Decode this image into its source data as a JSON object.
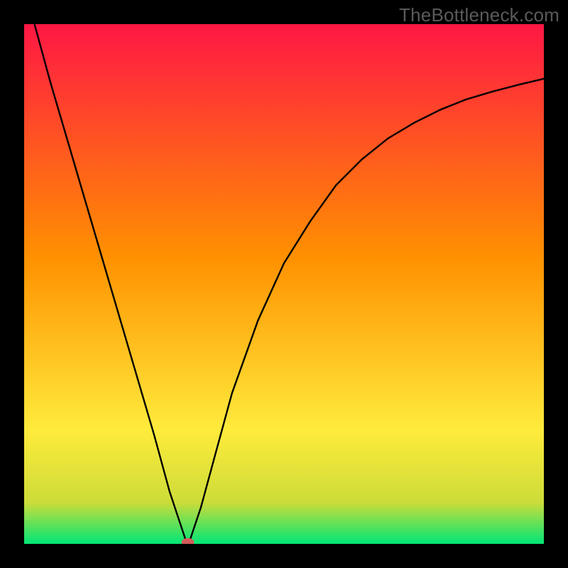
{
  "watermark": "TheBottleneck.com",
  "chart_data": {
    "type": "line",
    "title": "",
    "xlabel": "",
    "ylabel": "",
    "xlim": [
      0,
      1
    ],
    "ylim": [
      0,
      1
    ],
    "background_gradient": {
      "top": "#ff1744",
      "mid_upper": "#ff9100",
      "mid": "#ffeb3b",
      "mid_lower": "#cddc39",
      "bottom": "#00e676"
    },
    "series": [
      {
        "name": "curve",
        "color": "#000000",
        "comment": "V-shaped curve with sharp minimum; left branch nearly linear, right branch concave rising",
        "points": [
          {
            "x": 0.02,
            "y": 1.0
          },
          {
            "x": 0.05,
            "y": 0.89
          },
          {
            "x": 0.1,
            "y": 0.72
          },
          {
            "x": 0.15,
            "y": 0.55
          },
          {
            "x": 0.2,
            "y": 0.38
          },
          {
            "x": 0.25,
            "y": 0.21
          },
          {
            "x": 0.28,
            "y": 0.1
          },
          {
            "x": 0.3,
            "y": 0.04
          },
          {
            "x": 0.31,
            "y": 0.01
          },
          {
            "x": 0.315,
            "y": 0.0
          },
          {
            "x": 0.32,
            "y": 0.01
          },
          {
            "x": 0.34,
            "y": 0.07
          },
          {
            "x": 0.37,
            "y": 0.18
          },
          {
            "x": 0.4,
            "y": 0.29
          },
          {
            "x": 0.45,
            "y": 0.43
          },
          {
            "x": 0.5,
            "y": 0.54
          },
          {
            "x": 0.55,
            "y": 0.62
          },
          {
            "x": 0.6,
            "y": 0.69
          },
          {
            "x": 0.65,
            "y": 0.74
          },
          {
            "x": 0.7,
            "y": 0.78
          },
          {
            "x": 0.75,
            "y": 0.81
          },
          {
            "x": 0.8,
            "y": 0.835
          },
          {
            "x": 0.85,
            "y": 0.855
          },
          {
            "x": 0.9,
            "y": 0.87
          },
          {
            "x": 0.95,
            "y": 0.883
          },
          {
            "x": 1.0,
            "y": 0.895
          }
        ]
      }
    ],
    "marker": {
      "x": 0.315,
      "y": 0.003,
      "color": "#d45b5b",
      "rx": 0.012,
      "ry": 0.008
    }
  }
}
